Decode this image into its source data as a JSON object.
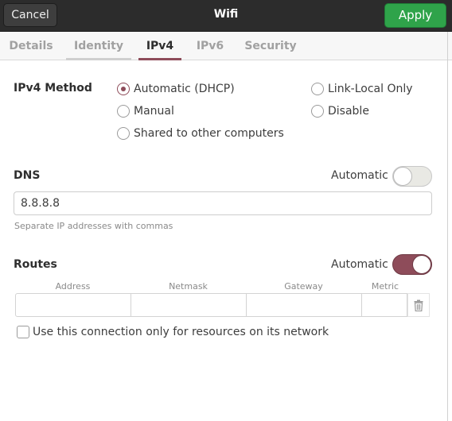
{
  "header": {
    "cancel_label": "Cancel",
    "title": "Wifi",
    "apply_label": "Apply"
  },
  "tabs": [
    {
      "label": "Details",
      "active": false
    },
    {
      "label": "Identity",
      "active": false
    },
    {
      "label": "IPv4",
      "active": true
    },
    {
      "label": "IPv6",
      "active": false
    },
    {
      "label": "Security",
      "active": false
    }
  ],
  "ipv4_method": {
    "label": "IPv4 Method",
    "options": [
      {
        "label": "Automatic (DHCP)",
        "checked": true
      },
      {
        "label": "Link-Local Only",
        "checked": false
      },
      {
        "label": "Manual",
        "checked": false
      },
      {
        "label": "Disable",
        "checked": false
      },
      {
        "label": "Shared to other computers",
        "checked": false
      }
    ]
  },
  "dns": {
    "label": "DNS",
    "automatic_label": "Automatic",
    "automatic_on": false,
    "value": "8.8.8.8",
    "hint": "Separate IP addresses with commas"
  },
  "routes": {
    "label": "Routes",
    "automatic_label": "Automatic",
    "automatic_on": true,
    "columns": [
      "Address",
      "Netmask",
      "Gateway",
      "Metric"
    ],
    "row": {
      "address": "",
      "netmask": "",
      "gateway": "",
      "metric": ""
    }
  },
  "restrict_checkbox": {
    "label": "Use this connection only for resources on its network",
    "checked": false
  },
  "colors": {
    "accent": "#8e4c5a",
    "apply_green": "#2fa34a",
    "headerbar": "#2c2c2c"
  },
  "icons": {
    "delete_route": "trash-icon"
  }
}
